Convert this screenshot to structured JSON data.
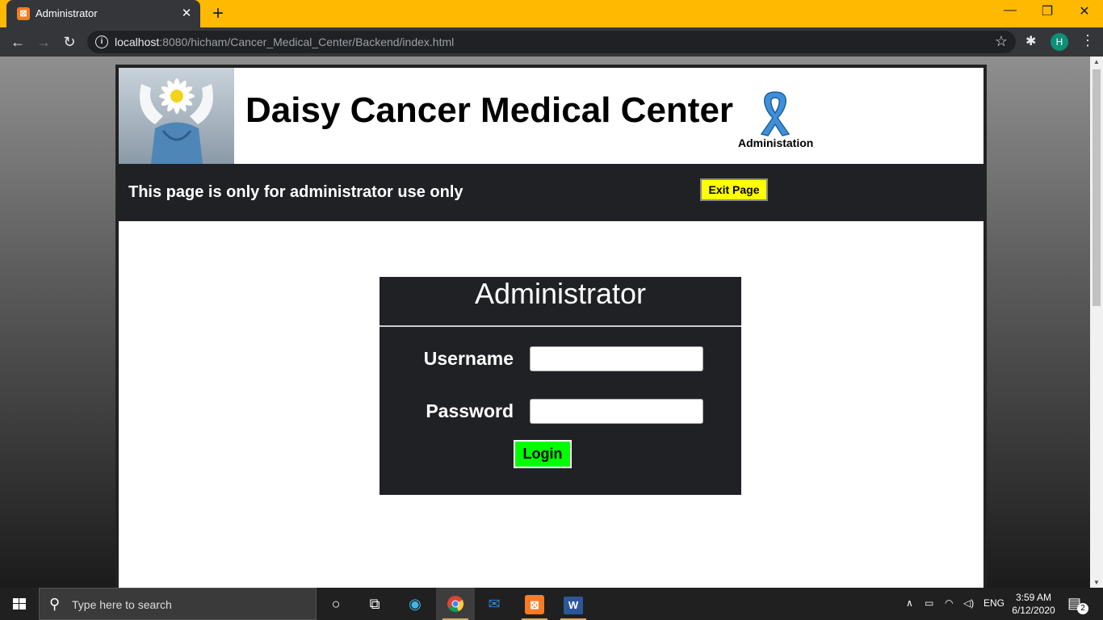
{
  "browser": {
    "tab_title": "Administrator",
    "tab_close": "✕",
    "new_tab": "+",
    "url_host": "localhost",
    "url_rest": ":8080/hicham/Cancer_Medical_Center/Backend/index.html",
    "profile_initial": "H",
    "window_controls": {
      "minimize": "—",
      "restore": "❐",
      "close": "✕"
    }
  },
  "page": {
    "site_title": "Daisy Cancer Medical Center",
    "admin_tag": "Administation",
    "notice": "This page is only for administrator use only",
    "exit_button": "Exit Page",
    "login": {
      "title": "Administrator",
      "username_label": "Username",
      "password_label": "Password",
      "username_value": "",
      "password_value": "",
      "login_button": "Login"
    }
  },
  "taskbar": {
    "search_placeholder": "Type here to search",
    "language": "ENG",
    "time": "3:59 AM",
    "date": "6/12/2020",
    "notification_count": "2"
  },
  "colors": {
    "tabbar": "#ffb900",
    "exit_button": "#ffff00",
    "login_button": "#00ff00",
    "dark_panel": "#202124"
  }
}
